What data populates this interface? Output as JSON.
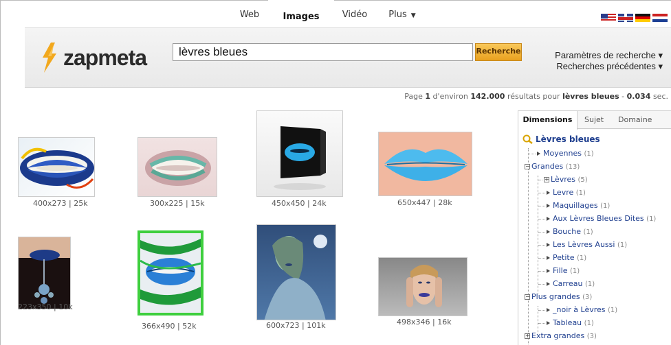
{
  "nav": {
    "tabs": [
      {
        "label": "Web"
      },
      {
        "label": "Images"
      },
      {
        "label": "Vidéo"
      },
      {
        "label": "Plus"
      }
    ]
  },
  "brand": {
    "name": "zapmeta",
    "accent": "#f2a81d"
  },
  "search": {
    "value": "lèvres bleues",
    "button": "Recherche"
  },
  "header_links": [
    "Paramètres de recherche ▾",
    "Recherches précédentes ▾"
  ],
  "results": {
    "prefix": "Page ",
    "page": "1",
    "mid1": " d'environ ",
    "count": "142.000",
    "mid2": " résultats pour ",
    "query": "lèvres bleues",
    "mid3": " - ",
    "time": "0.034",
    "suffix": " sec."
  },
  "images": [
    {
      "caption": "400x273 | 25k"
    },
    {
      "caption": "300x225 | 15k"
    },
    {
      "caption": "450x450 | 24k"
    },
    {
      "caption": "650x447 | 28k"
    },
    {
      "caption": "223x350 | 10k"
    },
    {
      "caption": "366x490 | 52k"
    },
    {
      "caption": "600x723 | 101k"
    },
    {
      "caption": "498x346 | 16k"
    }
  ],
  "panel": {
    "tabs": [
      "Dimensions",
      "Sujet",
      "Domaine"
    ],
    "root": "Lèvres bleues",
    "items": [
      {
        "label": "Moyennes",
        "count": "(1)"
      },
      {
        "label": "Grandes",
        "count": "(13)"
      },
      {
        "label": "Lèvres",
        "count": "(5)"
      },
      {
        "label": "Levre",
        "count": "(1)"
      },
      {
        "label": "Maquillages",
        "count": "(1)"
      },
      {
        "label": "Aux Lèvres Bleues Dites",
        "count": "(1)"
      },
      {
        "label": "Bouche",
        "count": "(1)"
      },
      {
        "label": "Les Lèvres Aussi",
        "count": "(1)"
      },
      {
        "label": "Petite",
        "count": "(1)"
      },
      {
        "label": "Fille",
        "count": "(1)"
      },
      {
        "label": "Carreau",
        "count": "(1)"
      },
      {
        "label": "Plus grandes",
        "count": "(3)"
      },
      {
        "label": "_noir à Lèvres",
        "count": "(1)"
      },
      {
        "label": "Tableau",
        "count": "(1)"
      },
      {
        "label": "Extra grandes",
        "count": "(3)"
      }
    ]
  }
}
